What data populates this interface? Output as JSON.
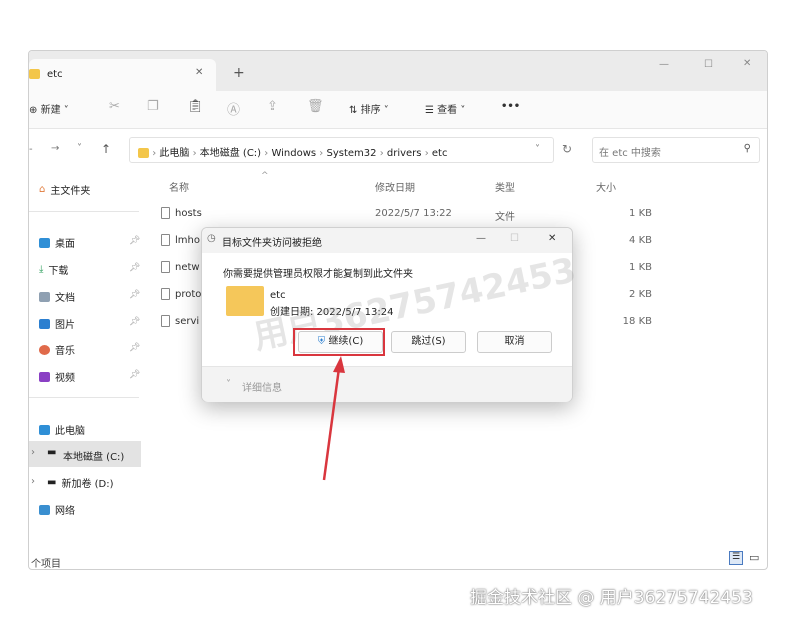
{
  "window": {
    "tab_title": "etc",
    "new_tab": "+",
    "controls": {
      "minimize": "—",
      "maximize": "☐",
      "close": "✕"
    }
  },
  "toolbar": {
    "new_label": "新建",
    "sort_label": "排序",
    "view_label": "查看",
    "more": "•••"
  },
  "address": {
    "crumbs": [
      "此电脑",
      "本地磁盘 (C:)",
      "Windows",
      "System32",
      "drivers",
      "etc"
    ],
    "search_placeholder": "在 etc 中搜索"
  },
  "sidebar": {
    "home": "主文件夹",
    "pinned": [
      "桌面",
      "下载",
      "文档",
      "图片",
      "音乐",
      "视频"
    ],
    "this_pc": "此电脑",
    "drive_c": "本地磁盘 (C:)",
    "drive_d": "新加卷 (D:)",
    "network": "网络"
  },
  "columns": {
    "name": "名称",
    "modified": "修改日期",
    "type": "类型",
    "size": "大小"
  },
  "files": [
    {
      "name": "hosts",
      "modified": "2022/5/7 13:22",
      "type": "文件",
      "size": "1 KB"
    },
    {
      "name": "lmho",
      "size": "4 KB"
    },
    {
      "name": "netw",
      "size": "1 KB"
    },
    {
      "name": "proto",
      "size": "2 KB"
    },
    {
      "name": "servi",
      "size": "18 KB"
    }
  ],
  "status": {
    "items_label": "个项目"
  },
  "dialog": {
    "title": "目标文件夹访问被拒绝",
    "message": "你需要提供管理员权限才能复制到此文件夹",
    "folder_name": "etc",
    "created": "创建日期: 2022/5/7 13:24",
    "continue": "继续(C)",
    "skip": "跳过(S)",
    "cancel": "取消",
    "details": "详细信息",
    "watermark": "用户36275742453"
  },
  "accent": "#d9363e",
  "watermark": "掘金技术社区 @ 用户36275742453"
}
